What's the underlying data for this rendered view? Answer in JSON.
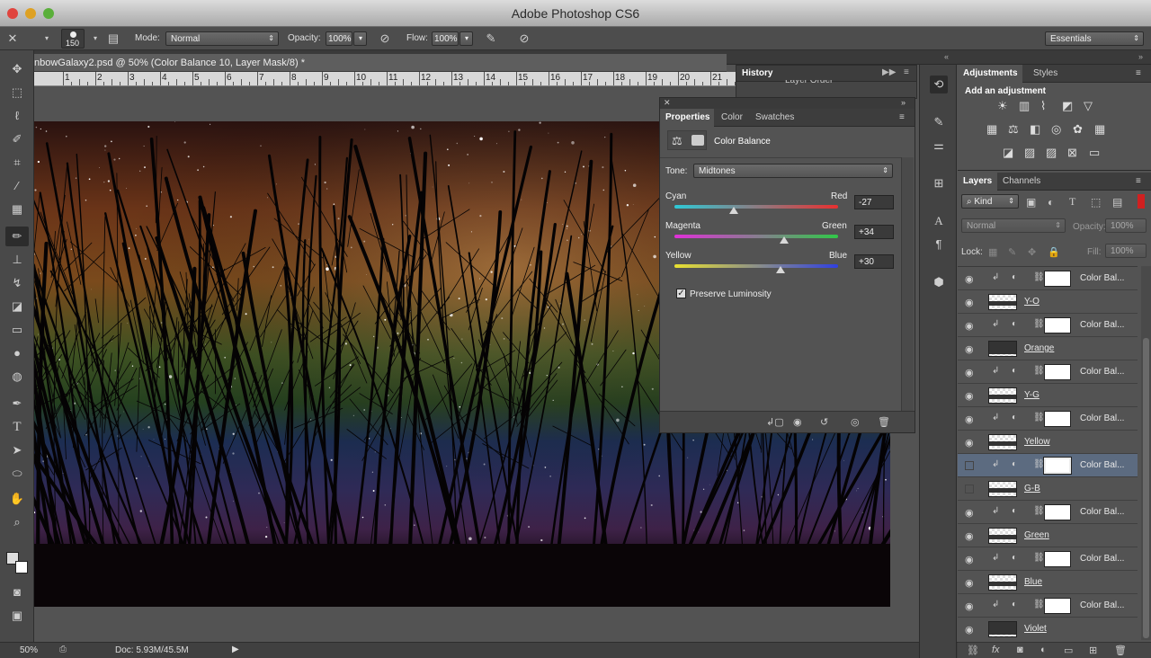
{
  "app": {
    "title": "Adobe Photoshop CS6"
  },
  "options_bar": {
    "brush_size": "150",
    "mode_label": "Mode:",
    "mode_value": "Normal",
    "opacity_label": "Opacity:",
    "opacity_value": "100%",
    "flow_label": "Flow:",
    "flow_value": "100%",
    "workspace": "Essentials"
  },
  "document": {
    "tab_title": "nbowGalaxy2.psd @ 50% (Color Balance 10, Layer Mask/8) *",
    "ruler_numbers": [
      "1",
      "2",
      "3",
      "4",
      "5",
      "6",
      "7",
      "8",
      "9",
      "10",
      "11",
      "12",
      "13",
      "14",
      "15",
      "16",
      "17",
      "18",
      "19",
      "20",
      "21"
    ]
  },
  "status": {
    "zoom": "50%",
    "doc": "Doc: 5.93M/45.5M"
  },
  "history": {
    "tab": "History",
    "item": "Layer Order"
  },
  "properties": {
    "tabs": [
      "Properties",
      "Color",
      "Swatches"
    ],
    "header": "Color Balance",
    "tone_label": "Tone:",
    "tone_value": "Midtones",
    "sliders": [
      {
        "left": "Cyan",
        "right": "Red",
        "value": "-27",
        "position": 0.365
      },
      {
        "left": "Magenta",
        "right": "Green",
        "value": "+34",
        "position": 0.67
      },
      {
        "left": "Yellow",
        "right": "Blue",
        "value": "+30",
        "position": 0.65
      }
    ],
    "preserve_label": "Preserve Luminosity",
    "preserve_checked": true
  },
  "adjustments": {
    "tabs": [
      "Adjustments",
      "Styles"
    ],
    "add_label": "Add an adjustment"
  },
  "layers_panel": {
    "tabs": [
      "Layers",
      "Channels"
    ],
    "kind": "Kind",
    "blend": "Normal",
    "opacity_label": "Opacity:",
    "opacity_value": "100%",
    "lock_label": "Lock:",
    "fill_label": "Fill:",
    "fill_value": "100%",
    "layers": [
      {
        "name": "Color Bal...",
        "type": "adjustment",
        "visible": true
      },
      {
        "name": "Y-O",
        "type": "raster",
        "visible": true
      },
      {
        "name": "Color Bal...",
        "type": "adjustment",
        "visible": true
      },
      {
        "name": "Orange",
        "type": "raster",
        "visible": true
      },
      {
        "name": "Color Bal...",
        "type": "adjustment",
        "visible": true
      },
      {
        "name": "Y-G",
        "type": "raster",
        "visible": true
      },
      {
        "name": "Color Bal...",
        "type": "adjustment",
        "visible": true
      },
      {
        "name": "Yellow",
        "type": "raster",
        "visible": true
      },
      {
        "name": "Color Bal...",
        "type": "adjustment",
        "visible": false,
        "selected": true
      },
      {
        "name": "G-B",
        "type": "raster",
        "visible": false
      },
      {
        "name": "Color Bal...",
        "type": "adjustment",
        "visible": true
      },
      {
        "name": "Green",
        "type": "raster",
        "visible": true
      },
      {
        "name": "Color Bal...",
        "type": "adjustment",
        "visible": true
      },
      {
        "name": "Blue",
        "type": "raster",
        "visible": true
      },
      {
        "name": "Color Bal...",
        "type": "adjustment",
        "visible": true
      },
      {
        "name": "Violet",
        "type": "raster",
        "visible": true
      }
    ]
  },
  "colors": {
    "panel": "#535353",
    "selection": "#5c6b80",
    "dark": "#3d3d3d"
  }
}
